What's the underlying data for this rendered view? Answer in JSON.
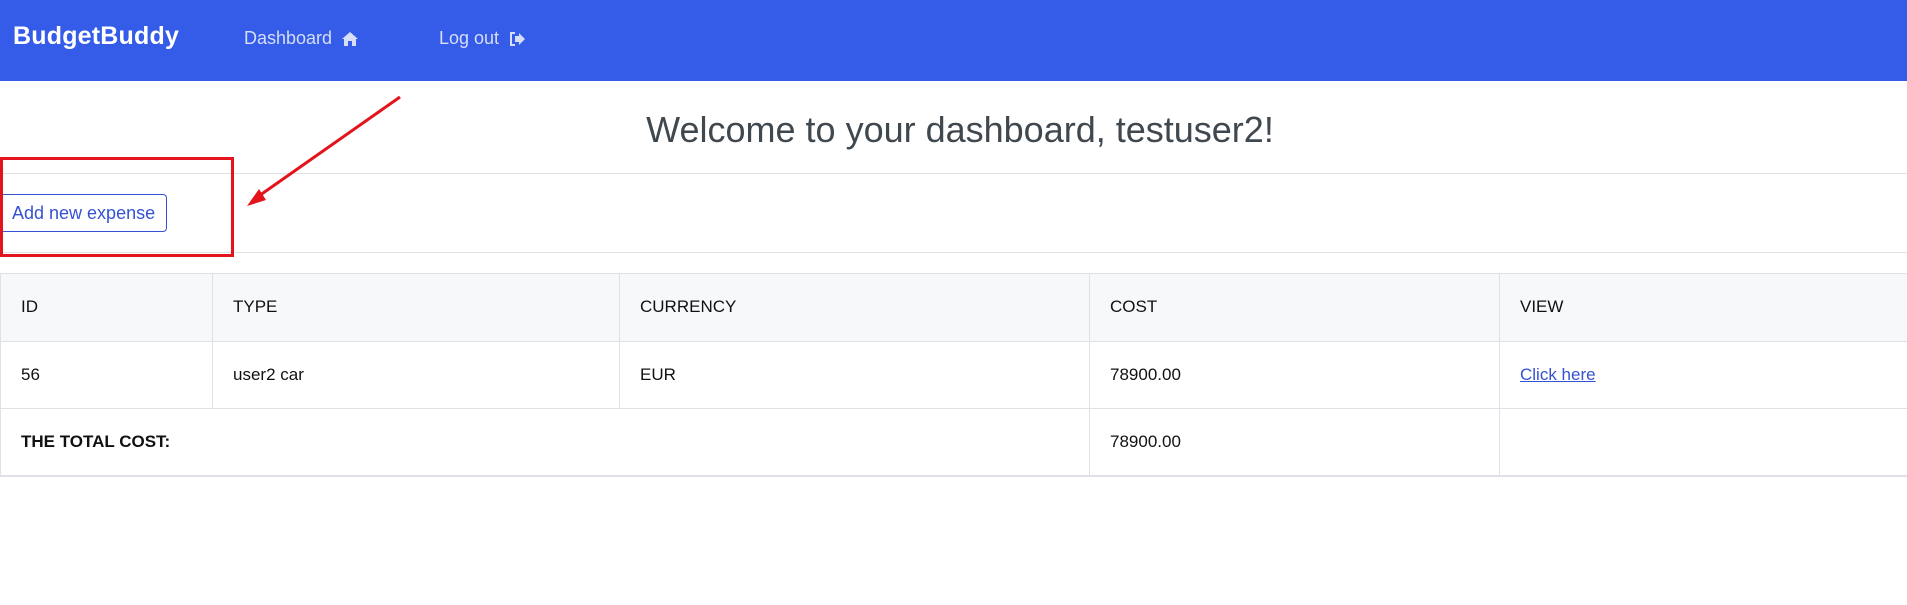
{
  "navbar": {
    "brand": "BudgetBuddy",
    "dashboard_label": "Dashboard",
    "dashboard_icon": "home-icon",
    "logout_label": "Log out",
    "logout_icon": "sign-out-icon",
    "background_color": "#355ce8"
  },
  "header": {
    "title": "Welcome to your dashboard, testuser2!"
  },
  "actions": {
    "add_expense_label": "Add new expense"
  },
  "annotation": {
    "color": "#e3141b",
    "description": ""
  },
  "expenses_table": {
    "columns": [
      "ID",
      "TYPE",
      "CURRENCY",
      "COST",
      "VIEW"
    ],
    "rows": [
      {
        "id": "56",
        "type": "user2 car",
        "currency": "EUR",
        "cost": "78900.00",
        "view": "Click here"
      }
    ],
    "total_label": "THE TOTAL COST:",
    "total_value": "78900.00"
  }
}
